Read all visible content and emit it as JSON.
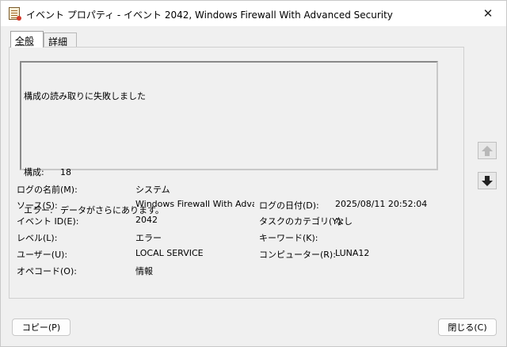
{
  "window": {
    "title": "イベント プロパティ - イベント 2042, Windows Firewall With Advanced Security",
    "close_glyph": "✕",
    "icon": "event-log-icon"
  },
  "tabs": [
    {
      "label": "全般",
      "active": true
    },
    {
      "label": "詳細",
      "active": false
    }
  ],
  "description": {
    "line1": "構成の読み取りに失敗しました",
    "config_label": "構成:",
    "config_value": "18",
    "error_label": "エラー:",
    "error_value": "データがさらにあります。"
  },
  "fields": {
    "log_name_label": "ログの名前(M):",
    "log_name_value": "システム",
    "source_label": "ソース(S):",
    "source_value": "Windows Firewall With Advanced Security",
    "logged_label": "ログの日付(D):",
    "logged_value": "2025/08/11 20:52:04",
    "event_id_label": "イベント ID(E):",
    "event_id_value": "2042",
    "task_category_label": "タスクのカテゴリ(Y):",
    "task_category_value": "なし",
    "level_label": "レベル(L):",
    "level_value": "エラー",
    "keywords_label": "キーワード(K):",
    "keywords_value": "",
    "user_label": "ユーザー(U):",
    "user_value": "LOCAL SERVICE",
    "computer_label": "コンピューター(R):",
    "computer_value": "LUNA12",
    "opcode_label": "オペコード(O):",
    "opcode_value": "情報"
  },
  "nav": {
    "up_icon": "arrow-up-icon",
    "down_icon": "arrow-down-icon"
  },
  "buttons": {
    "copy_label": "コピー(P)",
    "close_label": "閉じる(C)"
  }
}
